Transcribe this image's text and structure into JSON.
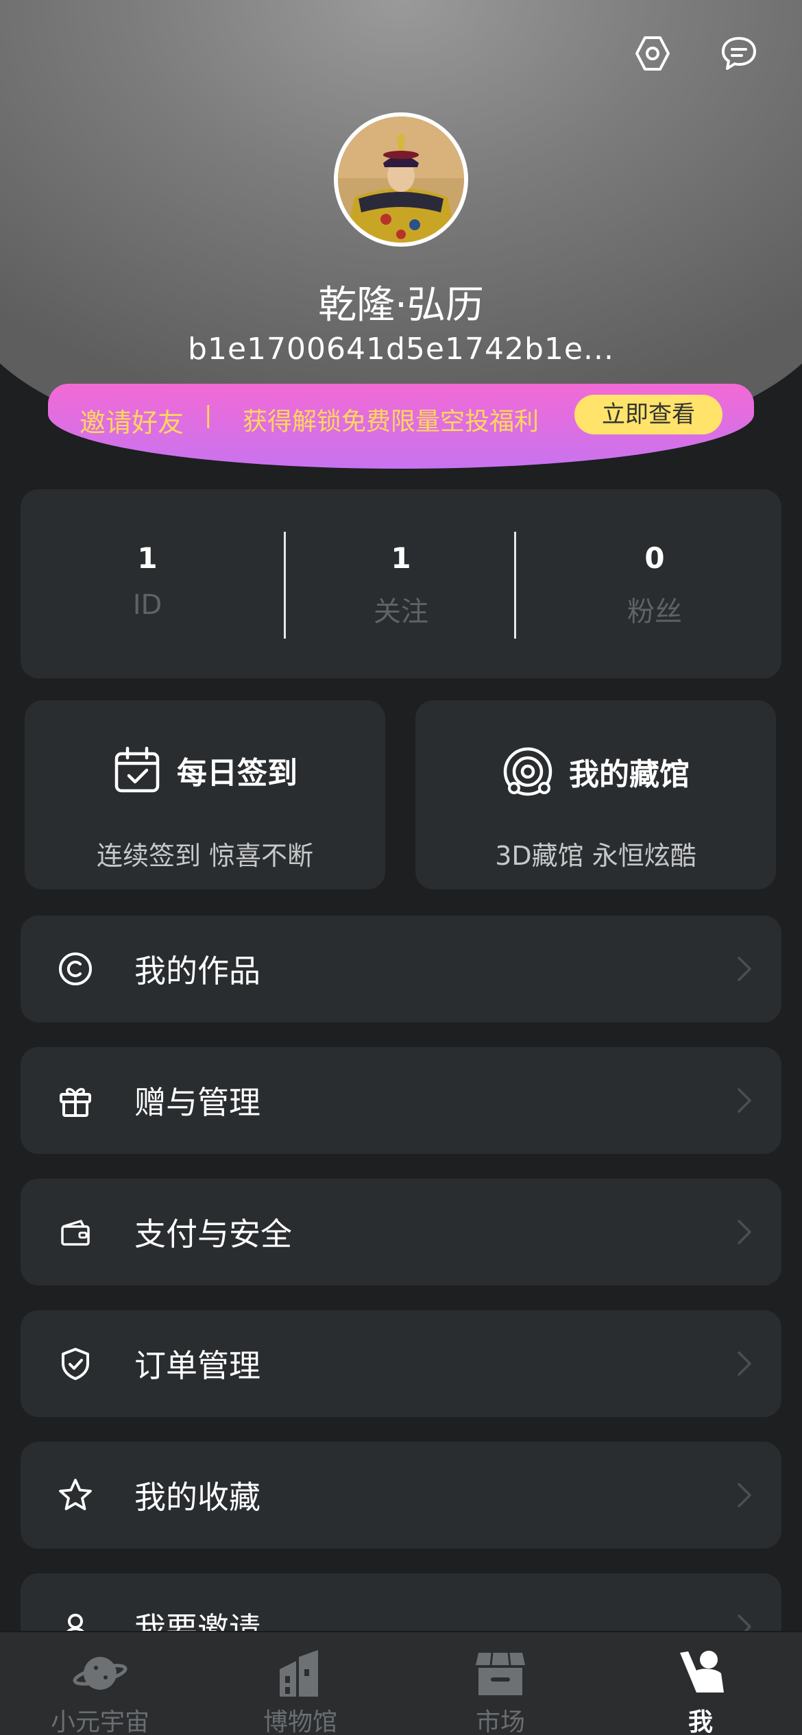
{
  "profile": {
    "name": "乾隆·弘历",
    "address": "b1e1700641d5e1742b1e..."
  },
  "banner": {
    "invite": "邀请好友",
    "separator": "|",
    "benefit": "获得解锁免费限量空投福利",
    "button": "立即查看"
  },
  "stats": [
    {
      "value": "1",
      "label": "ID"
    },
    {
      "value": "1",
      "label": "关注"
    },
    {
      "value": "0",
      "label": "粉丝"
    }
  ],
  "features": {
    "checkin": {
      "title": "每日签到",
      "subtitle": "连续签到 惊喜不断"
    },
    "museum": {
      "title": "我的藏馆",
      "subtitle": "3D藏馆 永恒炫酷"
    }
  },
  "menu": [
    {
      "label": "我的作品",
      "icon": "copyright-icon"
    },
    {
      "label": "赠与管理",
      "icon": "gift-icon"
    },
    {
      "label": "支付与安全",
      "icon": "wallet-icon"
    },
    {
      "label": "订单管理",
      "icon": "shield-check-icon"
    },
    {
      "label": "我的收藏",
      "icon": "star-icon"
    },
    {
      "label": "我要邀请",
      "icon": "user-icon"
    }
  ],
  "tabs": [
    {
      "label": "小元宇宙",
      "icon": "planet-icon"
    },
    {
      "label": "博物馆",
      "icon": "building-icon"
    },
    {
      "label": "市场",
      "icon": "store-icon"
    },
    {
      "label": "我",
      "icon": "person-wave-icon"
    }
  ],
  "colors": {
    "background": "#1d1f20",
    "card": "#2a2d2f",
    "accent_yellow": "#ffe36a",
    "banner_pink": "#f26ad5",
    "banner_purple": "#c873f0"
  }
}
